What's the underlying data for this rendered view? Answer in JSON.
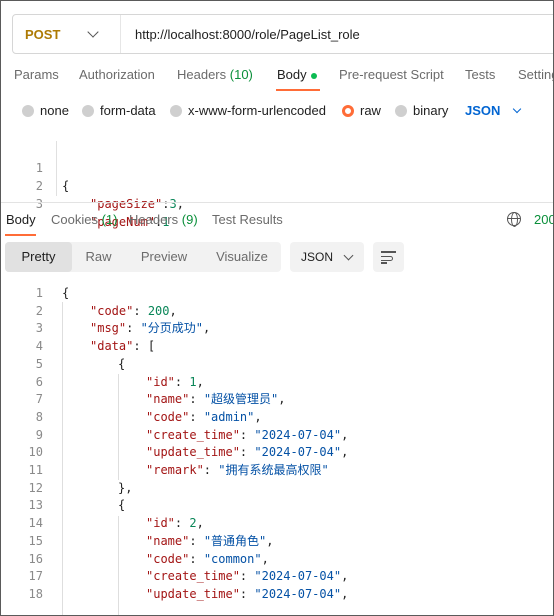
{
  "request": {
    "method": "POST",
    "url": "http://localhost:8000/role/PageList_role"
  },
  "request_tabs": [
    {
      "label": "Params"
    },
    {
      "label": "Authorization"
    },
    {
      "label": "Headers",
      "count": "(10)"
    },
    {
      "label": "Body",
      "active": true,
      "indicator": "green-dot"
    },
    {
      "label": "Pre-request Script"
    },
    {
      "label": "Tests"
    },
    {
      "label": "Settings"
    }
  ],
  "body_types": [
    {
      "label": "none"
    },
    {
      "label": "form-data"
    },
    {
      "label": "x-www-form-urlencoded"
    },
    {
      "label": "raw",
      "selected": true
    },
    {
      "label": "binary"
    }
  ],
  "raw_format": "JSON",
  "request_body": {
    "line_numbers": [
      "1",
      "2",
      "3"
    ],
    "open": "{",
    "fields": [
      {
        "key": "\"pageSize\"",
        "value": "3",
        "trail": ","
      },
      {
        "key": "\"pageNum\"",
        "value": "1",
        "trail": ""
      }
    ]
  },
  "response_tabs": [
    {
      "label": "Body",
      "active": true
    },
    {
      "label": "Cookies",
      "count": "(1)"
    },
    {
      "label": "Headers",
      "count": "(9)"
    },
    {
      "label": "Test Results"
    }
  ],
  "response_status": "200",
  "view_modes": [
    "Pretty",
    "Raw",
    "Preview",
    "Visualize"
  ],
  "active_view": "Pretty",
  "response_format": "JSON",
  "response_body": {
    "line_numbers": [
      "1",
      "2",
      "3",
      "4",
      "5",
      "6",
      "7",
      "8",
      "9",
      "10",
      "11",
      "12",
      "13",
      "14",
      "15",
      "16",
      "17",
      "18"
    ],
    "lines": [
      [
        "{"
      ],
      [
        "\"code\"",
        ": ",
        "200",
        ","
      ],
      [
        "\"msg\"",
        ": ",
        "\"分页成功\"",
        ","
      ],
      [
        "\"data\"",
        ": ",
        "",
        "["
      ],
      [
        "{"
      ],
      [
        "\"id\"",
        ": ",
        "1",
        ","
      ],
      [
        "\"name\"",
        ": ",
        "\"超级管理员\"",
        ","
      ],
      [
        "\"code\"",
        ": ",
        "\"admin\"",
        ","
      ],
      [
        "\"create_time\"",
        ": ",
        "\"2024-07-04\"",
        ","
      ],
      [
        "\"update_time\"",
        ": ",
        "\"2024-07-04\"",
        ","
      ],
      [
        "\"remark\"",
        ": ",
        "\"拥有系统最高权限\"",
        ""
      ],
      [
        "},"
      ],
      [
        "{"
      ],
      [
        "\"id\"",
        ": ",
        "2",
        ","
      ],
      [
        "\"name\"",
        ": ",
        "\"普通角色\"",
        ","
      ],
      [
        "\"code\"",
        ": ",
        "\"common\"",
        ","
      ],
      [
        "\"create_time\"",
        ": ",
        "\"2024-07-04\"",
        ","
      ],
      [
        "\"update_time\"",
        ": ",
        "\"2024-07-04\"",
        ","
      ]
    ]
  },
  "colors": {
    "accent": "#ff6c37",
    "method": "#ad7a03",
    "json_key": "#a31515",
    "json_string": "#0451a5",
    "json_number": "#098658",
    "status_ok": "#0a8f3a",
    "link_blue": "#0265d2"
  }
}
